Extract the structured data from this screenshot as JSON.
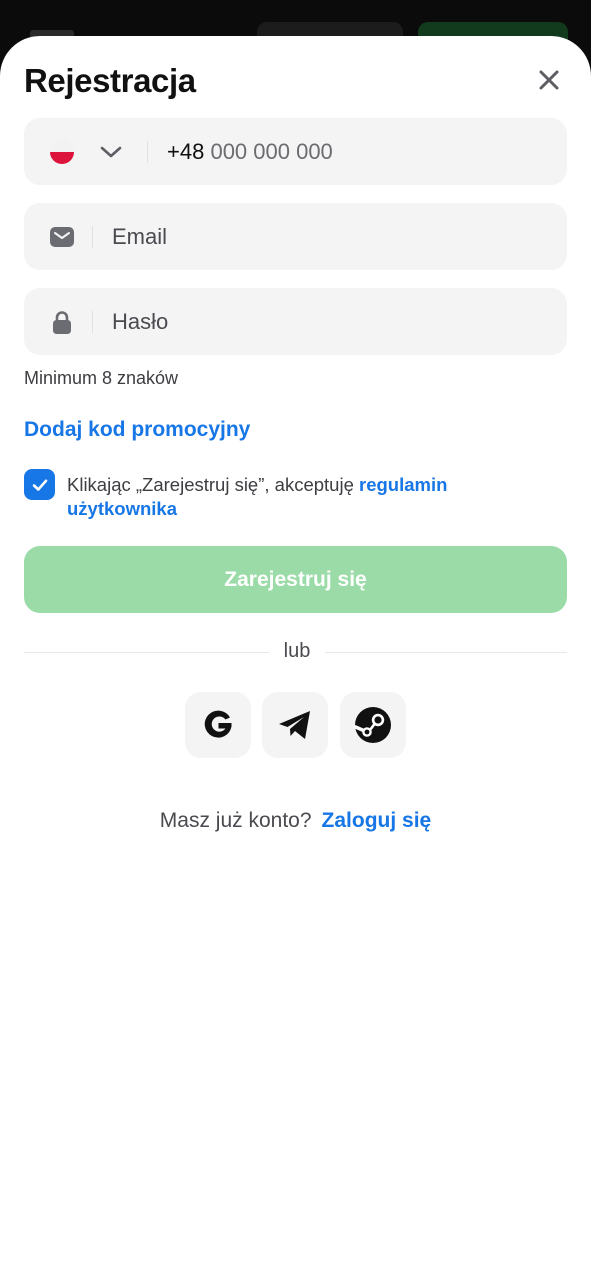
{
  "modal": {
    "title": "Rejestracja"
  },
  "phone": {
    "country_code": "+48",
    "placeholder": "000 000 000",
    "flag_icon": "poland-flag-icon",
    "chevron_icon": "chevron-down-icon"
  },
  "email": {
    "placeholder": "Email",
    "icon": "envelope-icon"
  },
  "password": {
    "placeholder": "Hasło",
    "icon": "lock-icon",
    "hint": "Minimum 8 znaków"
  },
  "promo": {
    "label": "Dodaj kod promocyjny"
  },
  "terms": {
    "checked": true,
    "text": "Klikając „Zarejestruj się”, akceptuję ",
    "link": "regulamin użytkownika"
  },
  "submit": {
    "label": "Zarejestruj się"
  },
  "divider": {
    "label": "lub"
  },
  "social": [
    "google-icon",
    "telegram-icon",
    "steam-icon"
  ],
  "footer": {
    "question": "Masz już konto?",
    "link": "Zaloguj się"
  },
  "colors": {
    "accent": "#1877e6",
    "submit_bg": "#9bdba7",
    "field_bg": "#f4f4f5"
  }
}
